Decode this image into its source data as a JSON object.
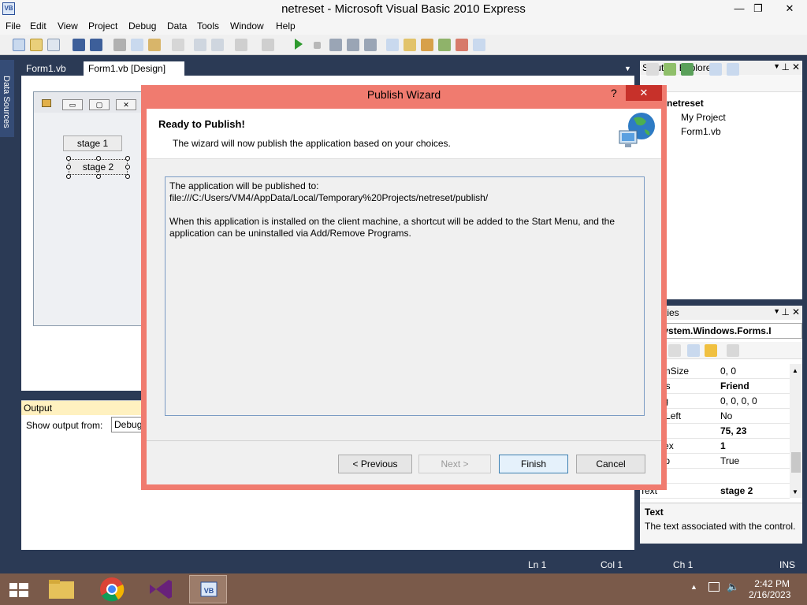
{
  "window": {
    "title": "netreset - Microsoft Visual Basic 2010 Express",
    "app_icon": "VB"
  },
  "menu": [
    "File",
    "Edit",
    "View",
    "Project",
    "Debug",
    "Data",
    "Tools",
    "Window",
    "Help"
  ],
  "side_strip": {
    "label": "Data Sources"
  },
  "doc_tabs": [
    {
      "label": "Form1.vb",
      "active": false
    },
    {
      "label": "Form1.vb [Design]",
      "active": true
    }
  ],
  "designer": {
    "buttons": [
      "stage 1",
      "stage 2"
    ]
  },
  "output": {
    "title": "Output",
    "show_label": "Show output from:",
    "show_value": "Debug"
  },
  "solution_explorer": {
    "title": "Solution Explorer",
    "items": [
      "netreset",
      "My Project",
      "Form1.vb"
    ]
  },
  "properties": {
    "title": "ties",
    "object": "n2  System.Windows.Forms.I",
    "rows": [
      {
        "key": "inimumSize",
        "value": "0, 0",
        "bold": false
      },
      {
        "key": "odifiers",
        "value": "Friend",
        "bold": true
      },
      {
        "key": "adding",
        "value": "0, 0, 0, 0",
        "bold": false
      },
      {
        "key": "ightToLeft",
        "value": "No",
        "bold": false
      },
      {
        "key": "ize",
        "value": "75, 23",
        "bold": true
      },
      {
        "key": "abIndex",
        "value": "1",
        "bold": true
      },
      {
        "key": "abStop",
        "value": "True",
        "bold": false
      },
      {
        "key": "ag",
        "value": "",
        "bold": false
      },
      {
        "key": "Text",
        "value": "stage 2",
        "bold": true
      }
    ],
    "desc_title": "Text",
    "desc_text": "The text associated with the control."
  },
  "statusbar": {
    "ln": "Ln 1",
    "col": "Col 1",
    "ch": "Ch 1",
    "mode": "INS"
  },
  "taskbar": {
    "time": "2:42 PM",
    "date": "2/16/2023"
  },
  "wizard": {
    "title": "Publish Wizard",
    "help": "?",
    "close": "✕",
    "heading": "Ready to Publish!",
    "subheading": "The wizard will now publish the application based on your choices.",
    "message": "The application will be published to:\nfile:///C:/Users/VM4/AppData/Local/Temporary%20Projects/netreset/publish/\n\nWhen this application is installed on the client machine, a shortcut will be added to the Start Menu, and the application can be uninstalled via Add/Remove Programs.",
    "buttons": {
      "previous": "< Previous",
      "next": "Next >",
      "finish": "Finish",
      "cancel": "Cancel"
    }
  }
}
